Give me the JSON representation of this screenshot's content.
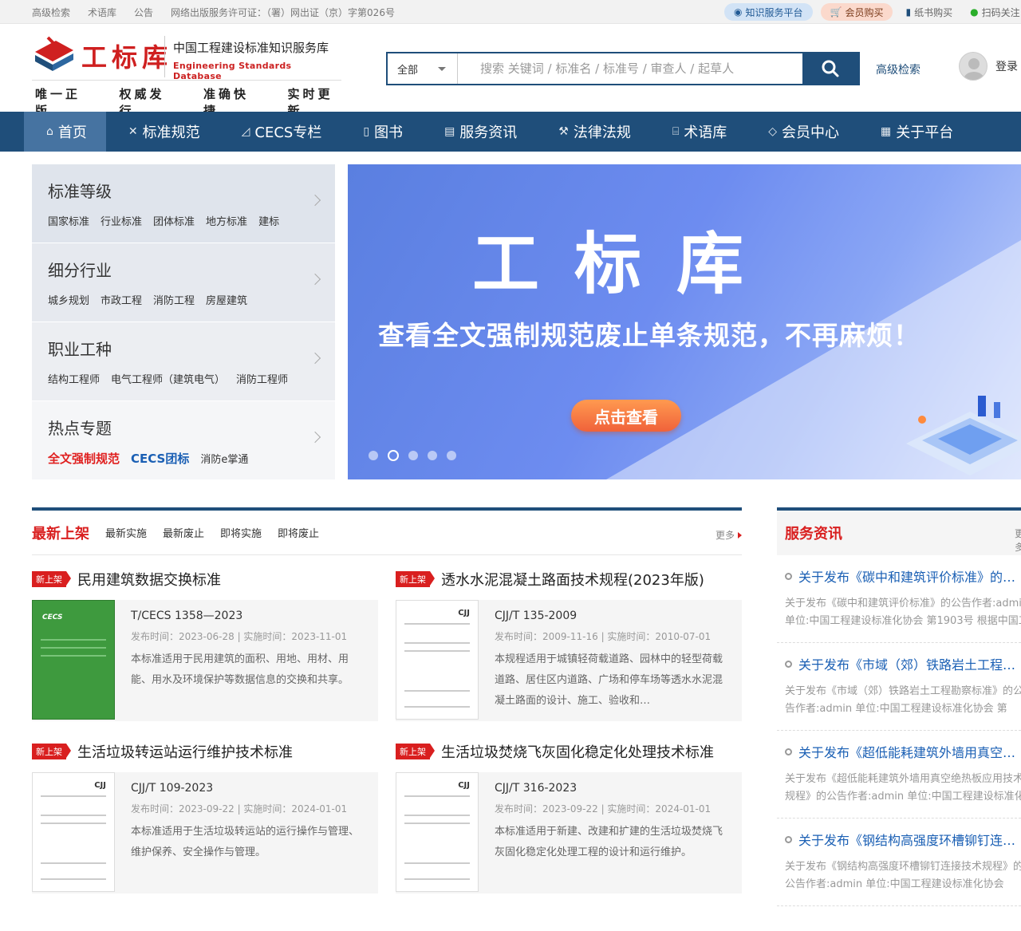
{
  "topbar": {
    "links": [
      "高级检索",
      "术语库",
      "公告",
      "网络出版服务许可证：（署）网出证（京）字第026号"
    ],
    "platform": "知识服务平台",
    "member_buy": "会员购买",
    "paper_buy": "纸书购买",
    "scan": "扫码关注"
  },
  "header": {
    "logo_text": "工标库",
    "site_name_cn": "中国工程建设标准知识服务库",
    "site_name_en": "Engineering Standards Database",
    "slogans": [
      "唯一正版",
      "权威发行",
      "准确快捷",
      "实时更新"
    ],
    "search_scope": "全部",
    "search_placeholder": "搜索 关键词 / 标准名 / 标准号 / 审查人 / 起草人",
    "advanced_search": "高级检索",
    "login": "登录"
  },
  "nav": {
    "items": [
      {
        "label": "首页",
        "icon": "home-icon"
      },
      {
        "label": "标准规范",
        "icon": "tools-icon"
      },
      {
        "label": "CECS专栏",
        "icon": "ruler-icon"
      },
      {
        "label": "图书",
        "icon": "book-icon"
      },
      {
        "label": "服务资讯",
        "icon": "news-icon"
      },
      {
        "label": "法律法规",
        "icon": "gavel-icon"
      },
      {
        "label": "术语库",
        "icon": "library-icon"
      },
      {
        "label": "会员中心",
        "icon": "diamond-icon"
      },
      {
        "label": "关于平台",
        "icon": "doc-icon"
      }
    ]
  },
  "categories": [
    {
      "title": "标准等级",
      "tags": [
        "国家标准",
        "行业标准",
        "团体标准",
        "地方标准",
        "建标"
      ]
    },
    {
      "title": "细分行业",
      "tags": [
        "城乡规划",
        "市政工程",
        "消防工程",
        "房屋建筑"
      ]
    },
    {
      "title": "职业工种",
      "tags": [
        "结构工程师",
        "电气工程师（建筑电气）",
        "消防工程师"
      ]
    },
    {
      "title": "热点专题",
      "tags": [
        "全文强制规范",
        "CECS团标",
        "消防e掌通"
      ]
    }
  ],
  "banner": {
    "title": "工标库",
    "subtitle": "查看全文强制规范废止单条规范，不再麻烦！",
    "cta": "点击查看"
  },
  "latest": {
    "tabs": [
      "最新上架",
      "最新实施",
      "最新废止",
      "即将实施",
      "即将废止"
    ],
    "more": "更多",
    "badge": "新上架",
    "cards": [
      {
        "title": "民用建筑数据交换标准",
        "code": "T/CECS 1358—2023",
        "publish": "发布时间：2023-06-28",
        "implement": "实施时间：2023-11-01",
        "desc": "本标准适用于民用建筑的面积、用地、用材、用能、用水及环境保护等数据信息的交换和共享。",
        "cover_brand": "CECS"
      },
      {
        "title": "透水水泥混凝土路面技术规程(2023年版)",
        "code": "CJJ/T 135-2009",
        "publish": "发布时间：2009-11-16",
        "implement": "实施时间：2010-07-01",
        "desc": "本规程适用于城镇轻荷载道路、园林中的轻型荷载道路、居住区内道路、广场和停车场等透水水泥混凝土路面的设计、施工、验收和…",
        "cover_brand": "CJJ"
      },
      {
        "title": "生活垃圾转运站运行维护技术标准",
        "code": "CJJ/T 109-2023",
        "publish": "发布时间：2023-09-22",
        "implement": "实施时间：2024-01-01",
        "desc": "本标准适用于生活垃圾转运站的运行操作与管理、维护保养、安全操作与管理。",
        "cover_brand": "CJJ"
      },
      {
        "title": "生活垃圾焚烧飞灰固化稳定化处理技术标准",
        "code": "CJJ/T 316-2023",
        "publish": "发布时间：2023-09-22",
        "implement": "实施时间：2024-01-01",
        "desc": "本标准适用于新建、改建和扩建的生活垃圾焚烧飞灰固化稳定化处理工程的设计和运行维护。",
        "cover_brand": "CJJ"
      }
    ]
  },
  "services": {
    "title": "服务资讯",
    "more": "更多",
    "items": [
      {
        "title": "关于发布《碳中和建筑评价标准》的公告",
        "excerpt": "关于发布《碳中和建筑评价标准》的公告作者:admin 单位:中国工程建设标准化协会 第1903号 根据中国工程建设标准化协会"
      },
      {
        "title": "关于发布《市域（郊）铁路岩土工程勘察标准》的公告",
        "excerpt": "关于发布《市域（郊）铁路岩土工程勘察标准》的公告作者:admin 单位:中国工程建设标准化协会 第"
      },
      {
        "title": "关于发布《超低能耗建筑外墙用真空绝热板应用技术规程》的公告",
        "excerpt": "关于发布《超低能耗建筑外墙用真空绝热板应用技术规程》的公告作者:admin 单位:中国工程建设标准化协会"
      },
      {
        "title": "关于发布《钢结构高强度环槽铆钉连接技术规程》的公告",
        "excerpt": "关于发布《钢结构高强度环槽铆钉连接技术规程》的公告作者:admin 单位:中国工程建设标准化协会"
      }
    ]
  },
  "colors": {
    "primary": "#1f4e7a",
    "accent_red": "#d91f1f",
    "link_blue": "#1a5fb4"
  }
}
